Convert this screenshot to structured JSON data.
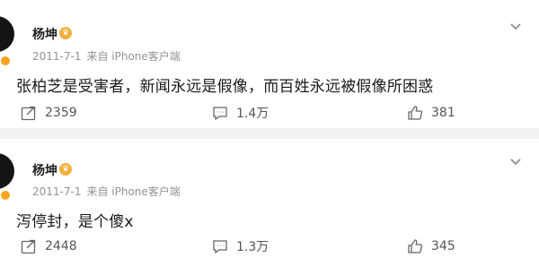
{
  "posts": [
    {
      "author": "杨坤",
      "date": "2011-7-1",
      "source": "来自 iPhone客户端",
      "text": "张柏芝是受害者，新闻永远是假像，而百姓永远被假像所困惑",
      "reposts": "2359",
      "comments": "1.4万",
      "likes": "381"
    },
    {
      "author": "杨坤",
      "date": "2011-7-1",
      "source": "来自 iPhone客户端",
      "text": "泻停封，是个傻x",
      "reposts": "2448",
      "comments": "1.3万",
      "likes": "345"
    }
  ],
  "colors": {
    "avatar": "#141414",
    "badge": "#f7a51e",
    "vip": "#f4b03f",
    "meta": "#939393"
  },
  "icons": {
    "repost": "repost-icon",
    "comment": "comment-icon",
    "like": "like-icon",
    "more": "chevron-down-icon",
    "vip": "vip-crown-icon"
  }
}
